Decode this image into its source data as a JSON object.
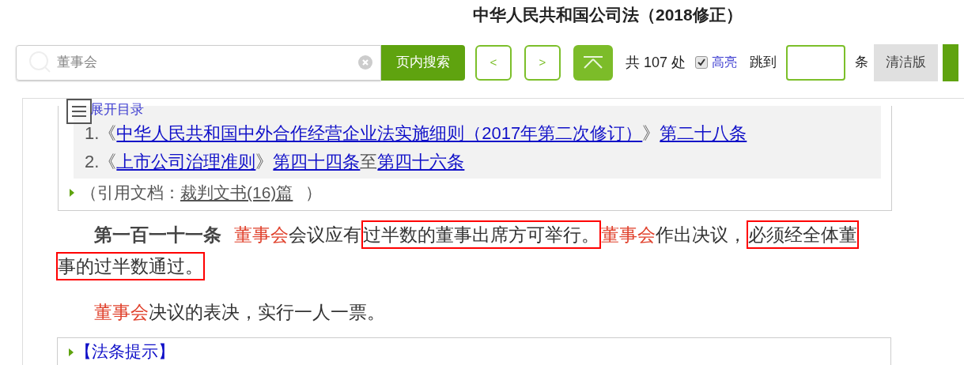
{
  "title": "中华人民共和国公司法（2018修正）",
  "toolbar": {
    "search": {
      "value": "董事会"
    },
    "search_button": "页内搜索",
    "prev": "<",
    "next": ">",
    "count_prefix": "共",
    "count": "107",
    "count_suffix": "处",
    "highlight": {
      "label": "高亮",
      "checked": true
    },
    "jump_label": "跳到",
    "jump_suffix": "条",
    "clean_button": "清洁版"
  },
  "toc_toggle": "展开目录",
  "references": [
    {
      "number": "1.",
      "open": "《",
      "title": "中华人民共和国中外合作经营企业法实施细则（2017年第二次修订）",
      "close": "》",
      "parts": [
        {
          "kind": "link",
          "text": "第二十八条"
        }
      ]
    },
    {
      "number": "2.",
      "open": "《",
      "title": "上市公司治理准则",
      "close": "》",
      "parts": [
        {
          "kind": "link",
          "text": "第四十四条"
        },
        {
          "kind": "plain",
          "text": "至"
        },
        {
          "kind": "link",
          "text": "第四十六条"
        }
      ]
    }
  ],
  "cited": {
    "prefix": "（引用文档：",
    "link": "裁判文书(16)篇",
    "suffix": "）"
  },
  "paragraphs": [
    [
      {
        "kind": "label",
        "text": "第一百一十一条"
      },
      {
        "kind": "term",
        "text": "董事会"
      },
      {
        "kind": "plain",
        "text": "会议应有"
      },
      {
        "kind": "boxed",
        "text": "过半数的董事出席方可举行。"
      },
      {
        "kind": "term",
        "text": "董事会"
      },
      {
        "kind": "plain",
        "text": "作出决议，"
      },
      {
        "kind": "boxed",
        "text": "必须经全体董"
      },
      {
        "kind": "boxed",
        "text": "事的过半数通过。"
      }
    ],
    [
      {
        "kind": "term",
        "text": "董事会"
      },
      {
        "kind": "plain",
        "text": "决议的表决，实行一人一票。"
      }
    ]
  ],
  "tips": "【法条提示】"
}
